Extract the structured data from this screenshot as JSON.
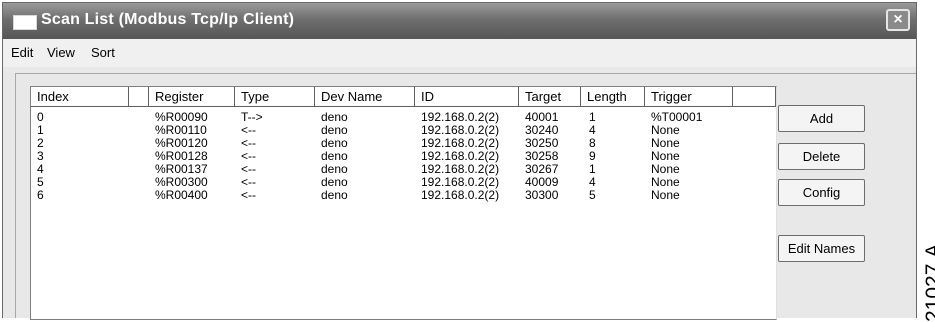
{
  "window": {
    "title": "Scan List (Modbus Tcp/Ip Client)",
    "close_glyph": "×"
  },
  "menu": [
    "Edit",
    "View",
    "Sort"
  ],
  "table": {
    "columns": [
      "Index",
      "",
      "Register",
      "Type",
      "Dev Name",
      "ID",
      "Target",
      "Length",
      "Trigger",
      ""
    ],
    "rows": [
      {
        "index": "0",
        "register": "%R00090",
        "type": "T-->",
        "dev_name": "deno",
        "id": "192.168.0.2(2)",
        "target": "40001",
        "length": "1",
        "trigger": "%T00001"
      },
      {
        "index": "1",
        "register": "%R00110",
        "type": "<--",
        "dev_name": "deno",
        "id": "192.168.0.2(2)",
        "target": "30240",
        "length": "4",
        "trigger": "None"
      },
      {
        "index": "2",
        "register": "%R00120",
        "type": "<--",
        "dev_name": "deno",
        "id": "192.168.0.2(2)",
        "target": "30250",
        "length": "8",
        "trigger": "None"
      },
      {
        "index": "3",
        "register": "%R00128",
        "type": "<--",
        "dev_name": "deno",
        "id": "192.168.0.2(2)",
        "target": "30258",
        "length": "9",
        "trigger": "None"
      },
      {
        "index": "4",
        "register": "%R00137",
        "type": "<--",
        "dev_name": "deno",
        "id": "192.168.0.2(2)",
        "target": "30267",
        "length": "1",
        "trigger": "None"
      },
      {
        "index": "5",
        "register": "%R00300",
        "type": "<--",
        "dev_name": "deno",
        "id": "192.168.0.2(2)",
        "target": "40009",
        "length": "4",
        "trigger": "None"
      },
      {
        "index": "6",
        "register": "%R00400",
        "type": "<--",
        "dev_name": "deno",
        "id": "192.168.0.2(2)",
        "target": "30300",
        "length": "5",
        "trigger": "None"
      }
    ]
  },
  "buttons": {
    "add": "Add",
    "delete": "Delete",
    "config": "Config",
    "edit_names": "Edit Names"
  },
  "figure_id": "21027.A"
}
